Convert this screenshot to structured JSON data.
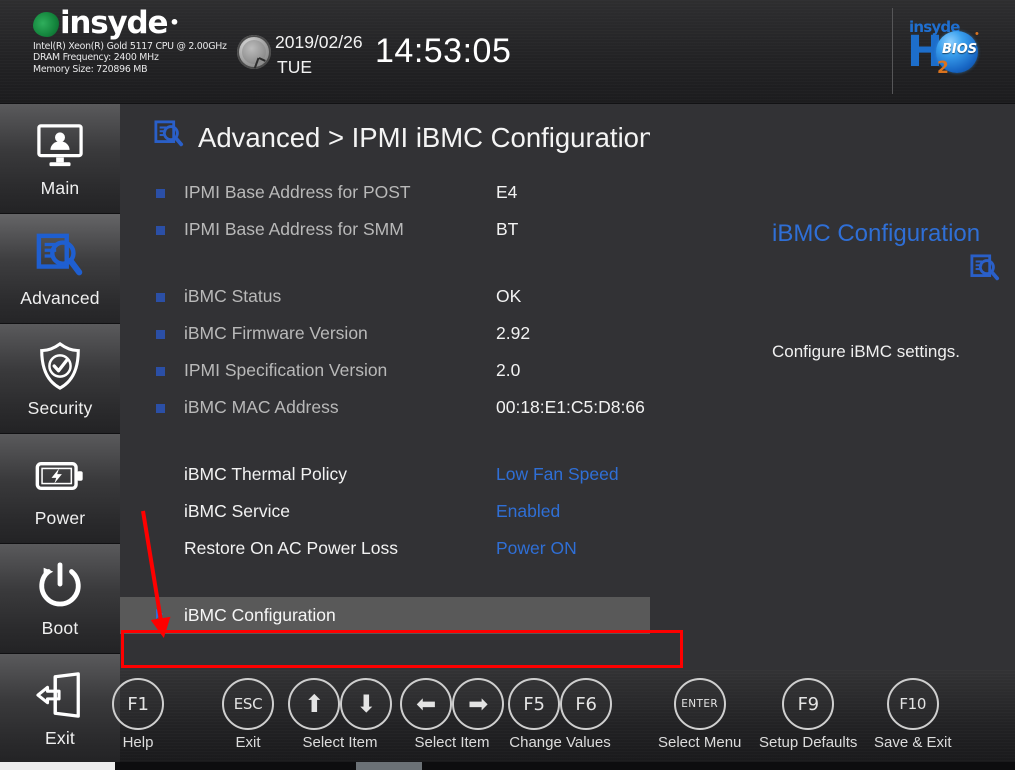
{
  "header": {
    "brand": "insyde",
    "system_info": "Intel(R) Xeon(R) Gold 5117 CPU @ 2.00GHz\nDRAM Frequency: 2400 MHz\nMemory Size: 720896 MB",
    "date": "2019/02/26",
    "weekday": "TUE",
    "time": "14:53:05",
    "logo": {
      "insyde": "insyde",
      "h": "H",
      "sub": "2",
      "bios": "BIOS",
      "star": "•"
    }
  },
  "sidebar": {
    "items": [
      {
        "label": "Main",
        "icon": "monitor-user-icon",
        "active": false
      },
      {
        "label": "Advanced",
        "icon": "document-search-icon",
        "active": true
      },
      {
        "label": "Security",
        "icon": "shield-check-icon",
        "active": false
      },
      {
        "label": "Power",
        "icon": "battery-bolt-icon",
        "active": false
      },
      {
        "label": "Boot",
        "icon": "power-restart-icon",
        "active": false
      },
      {
        "label": "Exit",
        "icon": "exit-door-icon",
        "active": false
      }
    ]
  },
  "main": {
    "breadcrumb_icon": "document-search-icon",
    "breadcrumb": "Advanced > IPMI iBMC Configuration",
    "rows": [
      {
        "type": "info",
        "label": "IPMI Base Address for POST",
        "value": "E4"
      },
      {
        "type": "info",
        "label": "IPMI Base Address for SMM",
        "value": "BT"
      },
      {
        "type": "spacer"
      },
      {
        "type": "info",
        "label": "iBMC Status",
        "value": "OK"
      },
      {
        "type": "info",
        "label": "iBMC Firmware Version",
        "value": "2.92"
      },
      {
        "type": "info",
        "label": "IPMI Specification Version",
        "value": "2.0"
      },
      {
        "type": "info",
        "label": "iBMC MAC Address",
        "value": "00:18:E1:C5:D8:66"
      },
      {
        "type": "spacer"
      },
      {
        "type": "editable",
        "label": "iBMC Thermal Policy",
        "value": "Low Fan Speed",
        "chevron": ">"
      },
      {
        "type": "editable",
        "label": "iBMC Service",
        "value": "Enabled",
        "chevron": ">"
      },
      {
        "type": "editable",
        "label": "Restore On AC Power Loss",
        "value": "Power ON",
        "chevron": ">"
      },
      {
        "type": "spacer"
      },
      {
        "type": "submenu",
        "label": "iBMC Configuration",
        "selected": true
      }
    ]
  },
  "help": {
    "title": "iBMC Configuration",
    "icon": "document-search-icon",
    "description": "Configure iBMC settings."
  },
  "footer": {
    "keys": [
      {
        "keys": [
          "F1"
        ],
        "label": "Help"
      },
      {
        "keys": [
          "ESC"
        ],
        "label": "Exit"
      },
      {
        "keys": [
          "⬆",
          "⬇"
        ],
        "label": "Select Item"
      },
      {
        "keys": [
          "⬅",
          "➡"
        ],
        "label": "Select Item"
      },
      {
        "keys": [
          "F5",
          "F6"
        ],
        "label": "Change Values"
      },
      {
        "keys": [
          "ENTER"
        ],
        "label": "Select Menu"
      },
      {
        "keys": [
          "F9"
        ],
        "label": "Setup Defaults"
      },
      {
        "keys": [
          "F10"
        ],
        "label": "Save & Exit"
      }
    ]
  },
  "annotation": {
    "arrow_color": "#fe0000",
    "highlight_target": "iBMC Configuration"
  },
  "colors": {
    "accent_blue": "#2f6fd6",
    "bullet_blue": "#2b4fa6",
    "background": "#323235",
    "sidebar_dark": "#1b1b1d",
    "selection": "#595959",
    "annotation_red": "#fe0000"
  }
}
